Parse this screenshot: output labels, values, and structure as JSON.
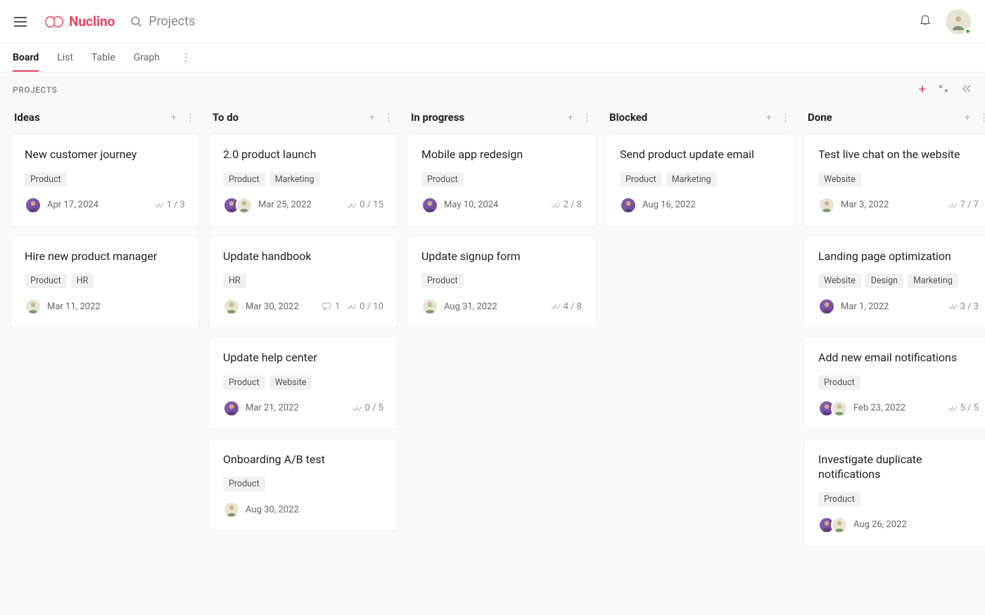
{
  "brand": "Nuclino",
  "search_placeholder": "Projects",
  "tabs": [
    {
      "label": "Board",
      "active": true
    },
    {
      "label": "List",
      "active": false
    },
    {
      "label": "Table",
      "active": false
    },
    {
      "label": "Graph",
      "active": false
    }
  ],
  "section_title": "PROJECTS",
  "columns": [
    {
      "title": "Ideas",
      "cards": [
        {
          "title": "New customer journey",
          "tags": [
            "Product"
          ],
          "assignees": [
            "purple"
          ],
          "date": "Apr 17, 2024",
          "progress": "1 / 3",
          "comments": null
        },
        {
          "title": "Hire new product manager",
          "tags": [
            "Product",
            "HR"
          ],
          "assignees": [
            "tan"
          ],
          "date": "Mar 11, 2022",
          "progress": null,
          "comments": null
        }
      ]
    },
    {
      "title": "To do",
      "cards": [
        {
          "title": "2.0 product launch",
          "tags": [
            "Product",
            "Marketing"
          ],
          "assignees": [
            "purple",
            "tan"
          ],
          "date": "Mar 25, 2022",
          "progress": "0 / 15",
          "comments": null
        },
        {
          "title": "Update handbook",
          "tags": [
            "HR"
          ],
          "assignees": [
            "tan"
          ],
          "date": "Mar 30, 2022",
          "progress": "0 / 10",
          "comments": "1"
        },
        {
          "title": "Update help center",
          "tags": [
            "Product",
            "Website"
          ],
          "assignees": [
            "purple"
          ],
          "date": "Mar 21, 2022",
          "progress": "0 / 5",
          "comments": null
        },
        {
          "title": "Onboarding A/B test",
          "tags": [
            "Product"
          ],
          "assignees": [
            "tan"
          ],
          "date": "Aug 30, 2022",
          "progress": null,
          "comments": null
        }
      ]
    },
    {
      "title": "In progress",
      "cards": [
        {
          "title": "Mobile app redesign",
          "tags": [
            "Product"
          ],
          "assignees": [
            "purple"
          ],
          "date": "May 10, 2024",
          "progress": "2 / 8",
          "comments": null
        },
        {
          "title": "Update signup form",
          "tags": [
            "Product"
          ],
          "assignees": [
            "tan"
          ],
          "date": "Aug 31, 2022",
          "progress": "4 / 8",
          "comments": null
        }
      ]
    },
    {
      "title": "Blocked",
      "cards": [
        {
          "title": "Send product update email",
          "tags": [
            "Product",
            "Marketing"
          ],
          "assignees": [
            "purple"
          ],
          "date": "Aug 16, 2022",
          "progress": null,
          "comments": null
        }
      ]
    },
    {
      "title": "Done",
      "cards": [
        {
          "title": "Test live chat on the website",
          "tags": [
            "Website"
          ],
          "assignees": [
            "tan"
          ],
          "date": "Mar 3, 2022",
          "progress": "7 / 7",
          "comments": null
        },
        {
          "title": "Landing page optimization",
          "tags": [
            "Website",
            "Design",
            "Marketing"
          ],
          "assignees": [
            "purple"
          ],
          "date": "Mar 1, 2022",
          "progress": "3 / 3",
          "comments": null
        },
        {
          "title": "Add new email notifications",
          "tags": [
            "Product"
          ],
          "assignees": [
            "purple",
            "tan"
          ],
          "date": "Feb 23, 2022",
          "progress": "5 / 5",
          "comments": null
        },
        {
          "title": "Investigate duplicate notifications",
          "tags": [
            "Product"
          ],
          "assignees": [
            "purple",
            "tan"
          ],
          "date": "Aug 26, 2022",
          "progress": null,
          "comments": null
        }
      ]
    }
  ]
}
